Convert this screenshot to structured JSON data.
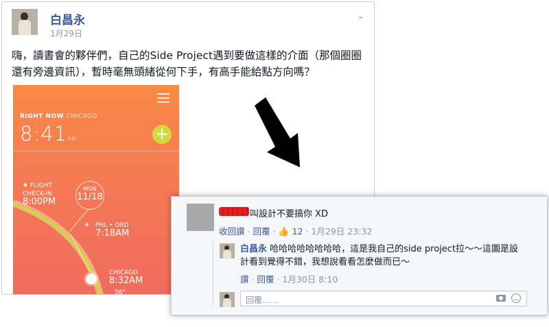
{
  "post": {
    "author": "白昌永",
    "date": "1月29日",
    "text": "嗨，讀書會的夥伴們，自己的Side Project遇到要做這樣的介面（那個圈圈還有旁邊資訊），暫時毫無頭緒從何下手，有高手能給點方向嗎？",
    "options_icon": "chevron-down-icon"
  },
  "app": {
    "right_now_label": "RIGHT NOW",
    "city": "CHICAGO",
    "time": "8:41",
    "time_ampm": "AM",
    "add_symbol": "+",
    "day_of_week": "MON",
    "day_date": "11/18",
    "flight_label": "FLIGHT",
    "checkin_label": "CHECK-IN",
    "checkin_time": "8:00PM",
    "route": "PHL • ORD",
    "route_time": "7:18AM",
    "arrival_city": "CHICAGO",
    "arrival_time": "8:32AM",
    "temperature": "56°",
    "colors": {
      "gradient_top": "#f88a44",
      "gradient_bottom": "#f06b5e",
      "accent": "#d2d93a"
    }
  },
  "comment": {
    "text": "叫設計不要搞你 XD",
    "actions": {
      "unlike": "收回讚",
      "reply": "回覆",
      "like_count": "12",
      "date": "1月29日 23:32"
    }
  },
  "reply": {
    "author": "白昌永",
    "text": "哈哈哈哈哈哈哈哈，這是我自己的side project拉～～這圖是設計看到覺得不錯，我想說看看怎麼做而已～",
    "actions": {
      "like": "讚",
      "reply": "回覆",
      "date": "1月30日 8:10"
    }
  },
  "reply_box": {
    "placeholder": "回覆……"
  },
  "accent_color": "#3b5998"
}
